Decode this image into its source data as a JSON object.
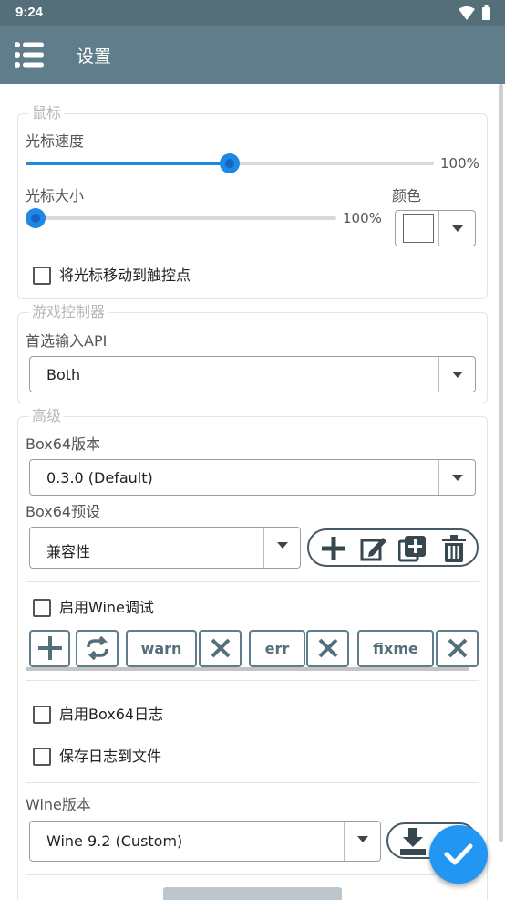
{
  "status_bar": {
    "time": "9:24"
  },
  "toolbar": {
    "title": "设置"
  },
  "mouse": {
    "legend": "鼠标",
    "cursor_speed": {
      "label": "光标速度",
      "value_text": "100%",
      "level": 0.5
    },
    "cursor_size": {
      "label": "光标大小",
      "value_text": "100%",
      "level": 0.0
    },
    "color": {
      "label": "颜色",
      "value": "#ffffff"
    },
    "move_to_touch": {
      "label": "将光标移动到触控点",
      "checked": false
    }
  },
  "game_controller": {
    "legend": "游戏控制器",
    "preferred_api": {
      "label": "首选输入API",
      "value": "Both"
    }
  },
  "advanced": {
    "legend": "高级",
    "box64_version": {
      "label": "Box64版本",
      "value": "0.3.0 (Default)"
    },
    "box64_preset": {
      "label": "Box64预设",
      "value": "兼容性"
    },
    "wine_debug": {
      "label": "启用Wine调试",
      "checked": false
    },
    "debug_channels": [
      "warn",
      "err",
      "fixme"
    ],
    "box64_log": {
      "label": "启用Box64日志",
      "checked": false
    },
    "save_log": {
      "label": "保存日志到文件",
      "checked": false
    },
    "wine_version": {
      "label": "Wine版本",
      "value": "Wine 9.2 (Custom)"
    }
  },
  "colors": {
    "toolbar": "#607d8b",
    "status_bar": "#546e7a",
    "accent": "#1e88e5",
    "fab": "#2196f3"
  }
}
